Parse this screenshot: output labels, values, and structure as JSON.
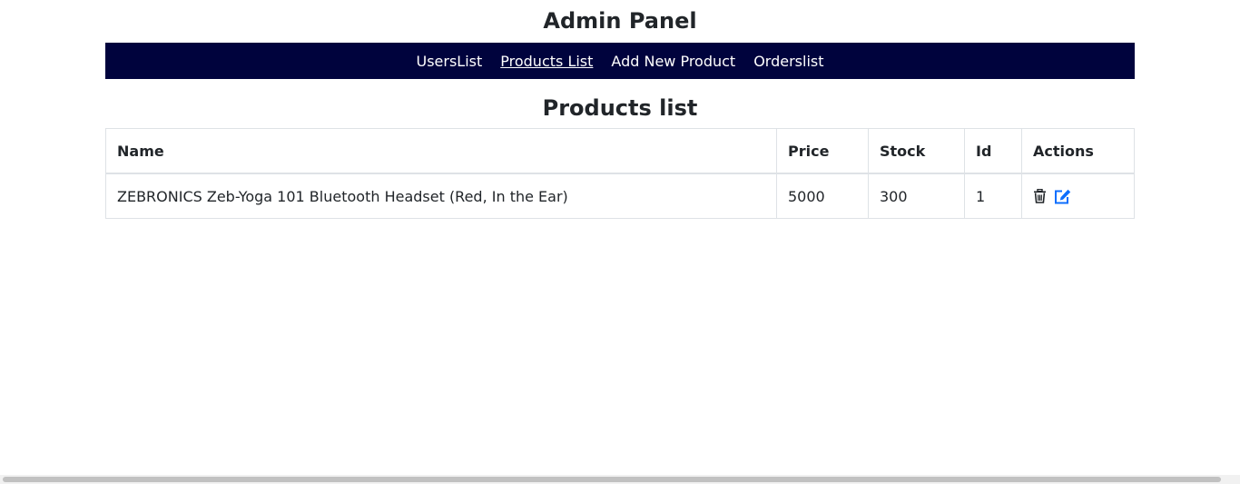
{
  "page": {
    "title": "Admin Panel"
  },
  "nav": {
    "items": [
      {
        "label": "UsersList",
        "active": false
      },
      {
        "label": "Products List",
        "active": true
      },
      {
        "label": "Add New Product",
        "active": false
      },
      {
        "label": "Orderslist",
        "active": false
      }
    ]
  },
  "section": {
    "title": "Products list"
  },
  "table": {
    "headers": {
      "name": "Name",
      "price": "Price",
      "stock": "Stock",
      "id": "Id",
      "actions": "Actions"
    },
    "rows": [
      {
        "name": "ZEBRONICS Zeb-Yoga 101 Bluetooth Headset (Red, In the Ear)",
        "price": "5000",
        "stock": "300",
        "id": "1",
        "actions": [
          "trash-icon",
          "edit-icon"
        ]
      }
    ]
  },
  "colors": {
    "navbar_bg": "#00033d",
    "nav_text": "#ffffff",
    "edit_icon": "#0d6efd",
    "trash_icon": "#212529",
    "border": "#dee2e6"
  }
}
